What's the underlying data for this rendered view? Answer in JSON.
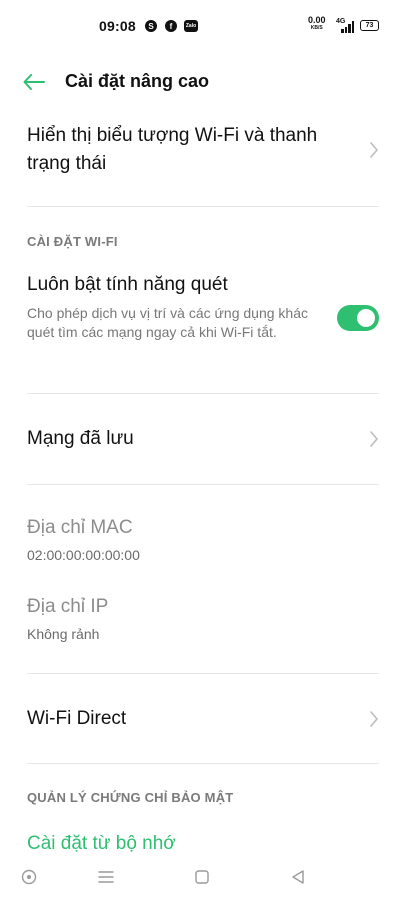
{
  "status_bar": {
    "time": "09:08",
    "apps": [
      "skype-icon",
      "facebook-icon",
      "zalo-icon"
    ],
    "skype_glyph": "S",
    "facebook_glyph": "f",
    "zalo_glyph": "Zalo",
    "net_speed": "0.00",
    "net_speed_unit": "KB/S",
    "network_type": "4G",
    "battery": "73"
  },
  "header": {
    "title": "Cài đặt nâng cao",
    "back_icon": "arrow-left-icon"
  },
  "rows": {
    "wifi_icon_status": {
      "title": "Hiển thị biểu tượng Wi-Fi và thanh trạng thái"
    },
    "wifi_settings_section": "CÀI ĐẶT WI-FI",
    "always_scan": {
      "title": "Luôn bật tính năng quét",
      "description": "Cho phép dịch vụ vị trí và các ứng dụng khác quét tìm các mạng ngay cả khi Wi-Fi tắt.",
      "enabled": true
    },
    "saved_networks": {
      "title": "Mạng đã lưu"
    },
    "mac_address": {
      "title": "Địa chỉ MAC",
      "value": "02:00:00:00:00:00"
    },
    "ip_address": {
      "title": "Địa chỉ IP",
      "value": "Không rảnh"
    },
    "wifi_direct": {
      "title": "Wi-Fi Direct"
    },
    "security_section": "QUẢN LÝ CHỨNG CHỈ BẢO MẬT",
    "install_from_storage": {
      "title": "Cài đặt từ bộ nhớ"
    }
  },
  "colors": {
    "accent": "#2fbf71",
    "text_primary": "#111111",
    "text_secondary": "#777777",
    "divider": "#e6e6e6"
  },
  "nav_bar": [
    "circle-icon",
    "menu-icon",
    "square-icon",
    "back-triangle-icon"
  ]
}
